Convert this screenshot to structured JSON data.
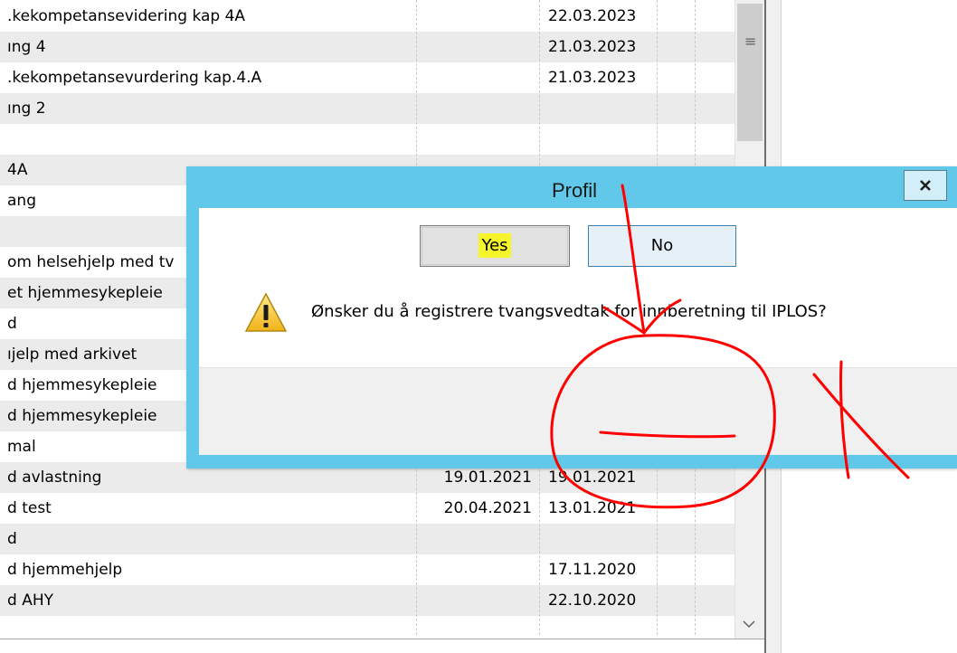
{
  "list": {
    "rows": [
      {
        "name": ".kekompetansevidering  kap  4A",
        "date1": "",
        "date2": "22.03.2023"
      },
      {
        "name": "ıng 4",
        "date1": "",
        "date2": "21.03.2023"
      },
      {
        "name": ".kekompetansevurdering kap.4.A",
        "date1": "",
        "date2": "21.03.2023"
      },
      {
        "name": "ıng 2",
        "date1": "",
        "date2": ""
      },
      {
        "name": "",
        "date1": "",
        "date2": ""
      },
      {
        "name": " 4A",
        "date1": "",
        "date2": ""
      },
      {
        "name": "ang",
        "date1": "",
        "date2": ""
      },
      {
        "name": "",
        "date1": "",
        "date2": ""
      },
      {
        "name": " om helsehjelp med tv",
        "date1": "",
        "date2": ""
      },
      {
        "name": "et hjemmesykepleie",
        "date1": "",
        "date2": ""
      },
      {
        "name": "d",
        "date1": "",
        "date2": ""
      },
      {
        "name": "ıjelp med arkivet",
        "date1": "",
        "date2": ""
      },
      {
        "name": "d hjemmesykepleie",
        "date1": "",
        "date2": ""
      },
      {
        "name": "d hjemmesykepleie",
        "date1": "",
        "date2": ""
      },
      {
        "name": "mal",
        "date1": "",
        "date2": ""
      },
      {
        "name": "d avlastning",
        "date1": "19.01.2021",
        "date2": "19.01.2021"
      },
      {
        "name": "d test",
        "date1": "20.04.2021",
        "date2": "13.01.2021"
      },
      {
        "name": "d",
        "date1": "",
        "date2": ""
      },
      {
        "name": "d hjemmehjelp",
        "date1": "",
        "date2": "17.11.2020"
      },
      {
        "name": "d AHY",
        "date1": "",
        "date2": "22.10.2020"
      }
    ]
  },
  "dialog": {
    "title": "Profil",
    "close_label": "x",
    "message": "Ønsker du å registrere tvangsvedtak for innberetning til IPLOS?",
    "yes_label": "Yes",
    "no_label": "No"
  },
  "icons": {
    "warning": "warning-icon",
    "close": "close-icon",
    "scroll_grip": "scroll-grip-icon",
    "scroll_down": "chevron-down-icon"
  },
  "colors": {
    "title_bar": "#62c8ea",
    "row_alt": "#ebebeb",
    "highlight": "#f5f52a",
    "annotation": "#ff0000"
  }
}
